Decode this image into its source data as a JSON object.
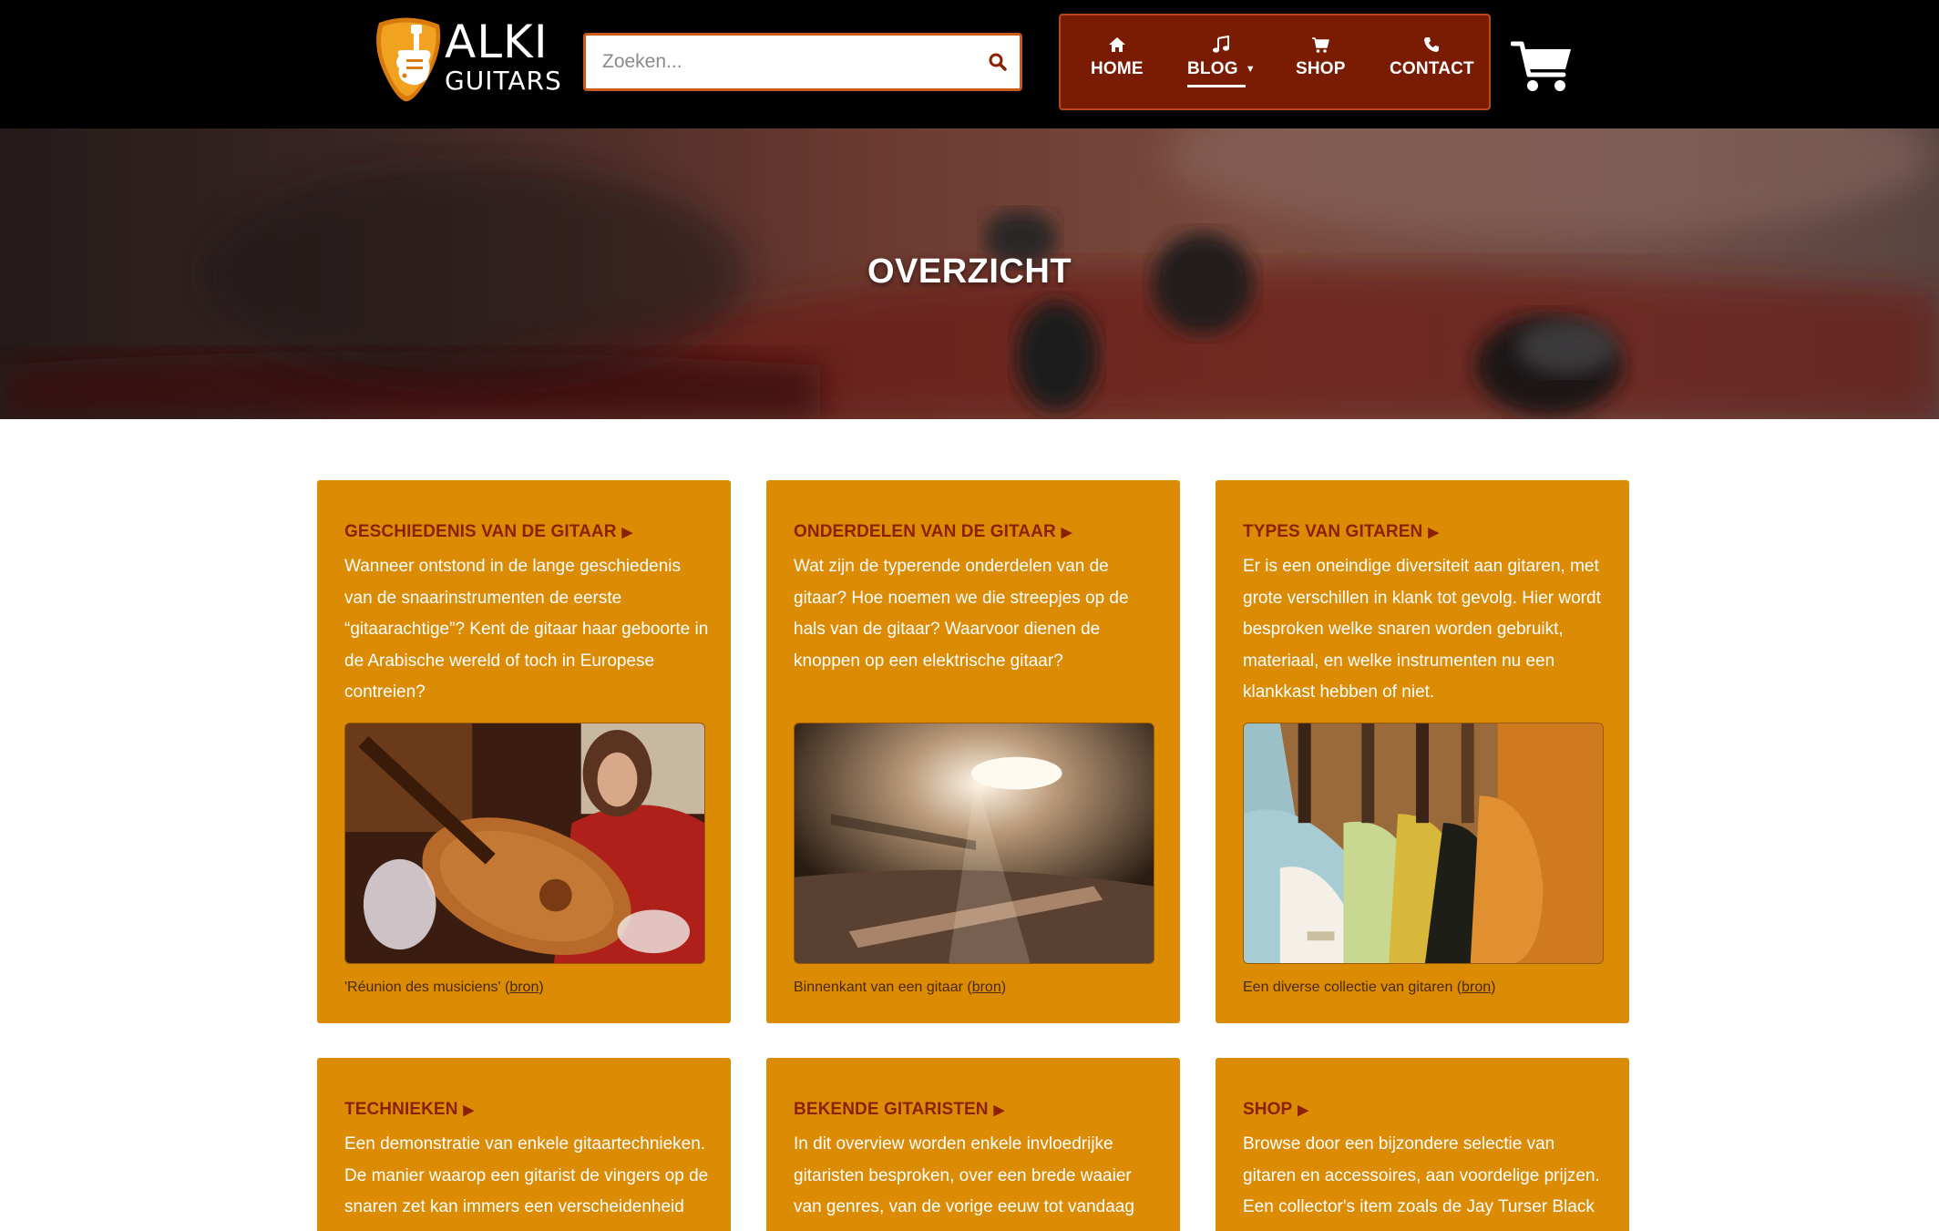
{
  "brand": {
    "name_line1": "ALKI",
    "name_line2": "GUITARS"
  },
  "search": {
    "placeholder": "Zoeken..."
  },
  "nav": {
    "items": [
      {
        "label": "HOME",
        "icon": "home-icon"
      },
      {
        "label": "BLOG",
        "icon": "music-note-icon",
        "caret": "▼",
        "active": true
      },
      {
        "label": "SHOP",
        "icon": "shopping-cart-icon"
      },
      {
        "label": "CONTACT",
        "icon": "phone-icon"
      }
    ]
  },
  "cart": {
    "icon": "cart-icon"
  },
  "hero": {
    "title": "OVERZICHT"
  },
  "cards": [
    {
      "title": "GESCHIEDENIS VAN DE GITAAR",
      "arrow": "▶",
      "text": "Wanneer ontstond in de lange geschiedenis van de snaarinstrumenten de eerste “gitaarachtige”? Kent de gitaar haar geboorte in de Arabische wereld of toch in Europese contreien?",
      "caption_prefix": "'Réunion des musiciens' (",
      "caption_link": "bron",
      "caption_suffix": ")"
    },
    {
      "title": "ONDERDELEN VAN DE GITAAR",
      "arrow": "▶",
      "text": "Wat zijn de typerende onderdelen van de gitaar? Hoe noemen we die streepjes op de hals van de gitaar? Waarvoor dienen de knoppen op een elektrische gitaar?",
      "caption_prefix": "Binnenkant van een gitaar (",
      "caption_link": "bron",
      "caption_suffix": ")"
    },
    {
      "title": "TYPES VAN GITAREN",
      "arrow": "▶",
      "text": "Er is een oneindige diversiteit aan gitaren, met grote verschillen in klank tot gevolg. Hier wordt besproken welke snaren worden gebruikt, materiaal, en welke instrumenten nu een klankkast hebben of niet.",
      "caption_prefix": "Een diverse collectie van gitaren (",
      "caption_link": "bron",
      "caption_suffix": ")"
    },
    {
      "title": "TECHNIEKEN",
      "arrow": "▶",
      "text": "Een demonstratie van enkele gitaartechnieken. De manier waarop een gitarist de vingers op de snaren zet kan immers een verscheidenheid van"
    },
    {
      "title": "BEKENDE GITARISTEN",
      "arrow": "▶",
      "text": "In dit overview worden enkele invloedrijke gitaristen besproken, over een brede waaier van genres, van de vorige eeuw tot vandaag de dag."
    },
    {
      "title": "SHOP",
      "arrow": "▶",
      "text": "Browse door een bijzondere selectie van gitaren en accessoires, aan voordelige prijzen. Een collector's item zoals de Jay Turser Black Eagle"
    }
  ],
  "colors": {
    "header_bg": "#000000",
    "nav_bg": "#7a1c04",
    "card_bg": "#dc8b05",
    "card_title": "#8c2004",
    "search_border": "#c85a1a"
  }
}
